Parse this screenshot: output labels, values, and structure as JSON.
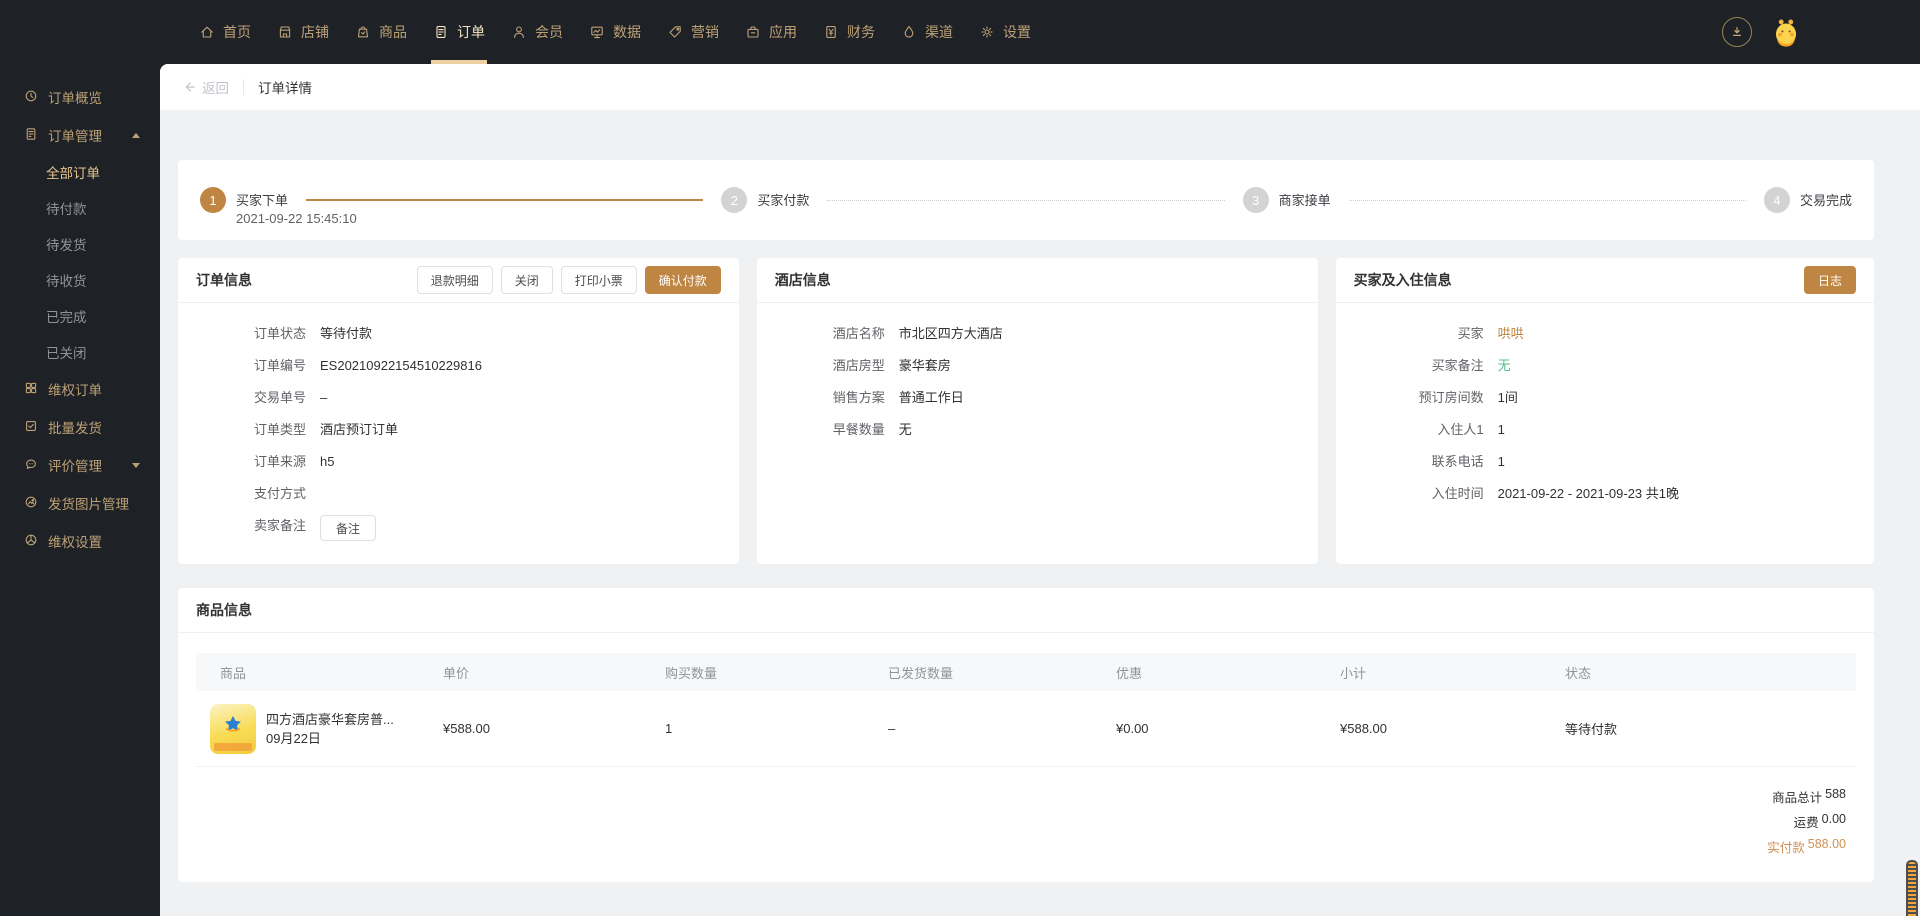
{
  "topnav": {
    "items": [
      {
        "label": "首页",
        "icon": "home-icon",
        "active": false
      },
      {
        "label": "店铺",
        "icon": "shop-icon",
        "active": false
      },
      {
        "label": "商品",
        "icon": "goods-icon",
        "active": false
      },
      {
        "label": "订单",
        "icon": "order-icon",
        "active": true
      },
      {
        "label": "会员",
        "icon": "member-icon",
        "active": false
      },
      {
        "label": "数据",
        "icon": "data-icon",
        "active": false
      },
      {
        "label": "营销",
        "icon": "marketing-icon",
        "active": false
      },
      {
        "label": "应用",
        "icon": "apps-icon",
        "active": false
      },
      {
        "label": "财务",
        "icon": "finance-icon",
        "active": false
      },
      {
        "label": "渠道",
        "icon": "channel-icon",
        "active": false
      },
      {
        "label": "设置",
        "icon": "settings-icon",
        "active": false
      }
    ]
  },
  "sidebar": {
    "items": [
      {
        "label": "订单概览",
        "icon": "clock-icon"
      },
      {
        "label": "订单管理",
        "icon": "document-icon",
        "expanded": true,
        "children": [
          "全部订单",
          "待付款",
          "待发货",
          "待收货",
          "已完成",
          "已关闭"
        ],
        "active_child": "全部订单"
      },
      {
        "label": "维权订单",
        "icon": "grid-icon"
      },
      {
        "label": "批量发货",
        "icon": "check-doc-icon"
      },
      {
        "label": "评价管理",
        "icon": "chat-icon",
        "expanded": false
      },
      {
        "label": "发货图片管理",
        "icon": "image-icon"
      },
      {
        "label": "维权设置",
        "icon": "gear-circle-icon"
      }
    ]
  },
  "page_header": {
    "back_label": "返回",
    "title": "订单详情"
  },
  "steps": [
    {
      "num": "1",
      "label": "买家下单",
      "time": "2021-09-22 15:45:10",
      "state": "done"
    },
    {
      "num": "2",
      "label": "买家付款",
      "state": "pending"
    },
    {
      "num": "3",
      "label": "商家接单",
      "state": "pending"
    },
    {
      "num": "4",
      "label": "交易完成",
      "state": "pending"
    }
  ],
  "order_card": {
    "title": "订单信息",
    "buttons": {
      "refund": "退款明细",
      "close": "关闭",
      "print": "打印小票",
      "confirm": "确认付款"
    },
    "fields": [
      {
        "label": "订单状态",
        "value": "等待付款"
      },
      {
        "label": "订单编号",
        "value": "ES20210922154510229816"
      },
      {
        "label": "交易单号",
        "value": "–"
      },
      {
        "label": "订单类型",
        "value": "酒店预订订单"
      },
      {
        "label": "订单来源",
        "value": "h5"
      },
      {
        "label": "支付方式",
        "value": ""
      },
      {
        "label": "卖家备注",
        "button": "备注"
      }
    ]
  },
  "hotel_card": {
    "title": "酒店信息",
    "fields": [
      {
        "label": "酒店名称",
        "value": "市北区四方大酒店"
      },
      {
        "label": "酒店房型",
        "value": "豪华套房"
      },
      {
        "label": "销售方案",
        "value": "普通工作日"
      },
      {
        "label": "早餐数量",
        "value": "无"
      }
    ]
  },
  "buyer_card": {
    "title": "买家及入住信息",
    "log_button": "日志",
    "fields": [
      {
        "label": "买家",
        "value": "哄哄",
        "style": "link"
      },
      {
        "label": "买家备注",
        "value": "无",
        "style": "green"
      },
      {
        "label": "预订房间数",
        "value": "1间"
      },
      {
        "label": "入住人1",
        "value": "1"
      },
      {
        "label": "联系电话",
        "value": "1"
      },
      {
        "label": "入住时间",
        "value": "2021-09-22 - 2021-09-23 共1晚"
      }
    ]
  },
  "product_card": {
    "title": "商品信息",
    "columns": [
      "商品",
      "单价",
      "购买数量",
      "已发货数量",
      "优惠",
      "小计",
      "状态"
    ],
    "rows": [
      {
        "name": "四方酒店豪华套房普...",
        "date": "09月22日",
        "price": "¥588.00",
        "qty": "1",
        "shipped": "–",
        "discount": "¥0.00",
        "subtotal": "¥588.00",
        "status": "等待付款"
      }
    ],
    "totals": [
      {
        "label": "商品总计",
        "value": "588"
      },
      {
        "label": "运费",
        "value": "0.00"
      },
      {
        "label": "实付款",
        "value": "588.00",
        "highlight": true
      }
    ]
  },
  "colors": {
    "accent": "#bf8543",
    "accent_light": "#cf9055",
    "green": "#56bd8d",
    "dark": "#1e2126",
    "nav_tan": "#bda176"
  }
}
